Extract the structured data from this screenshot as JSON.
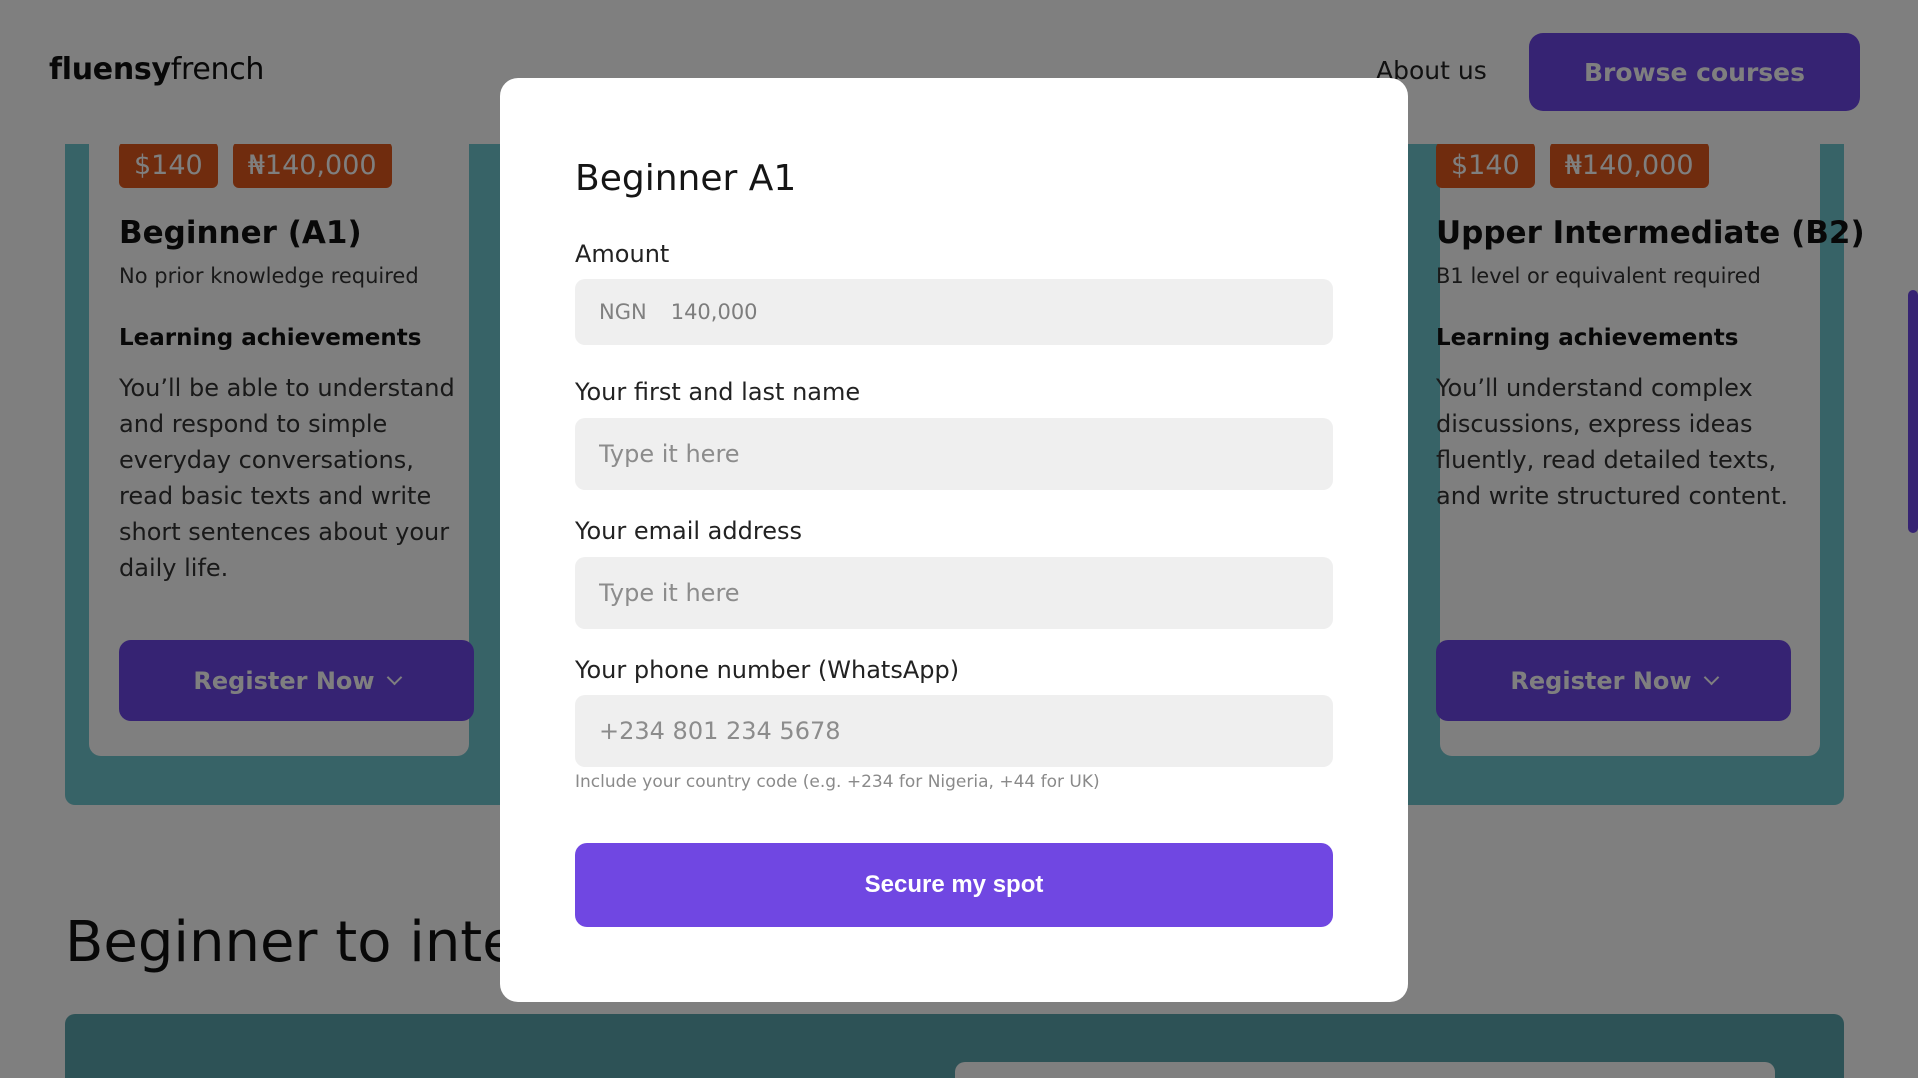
{
  "nav": {
    "logo_bold": "fluensy",
    "logo_rest": "french",
    "about_link": "About us",
    "browse_button": "Browse courses"
  },
  "cards": {
    "left": {
      "price_usd": "$140",
      "price_ngn": "₦140,000",
      "title": "Beginner (A1)",
      "subtitle": "No prior knowledge required",
      "heading": "Learning achievements",
      "body": "You’ll be able to understand and respond to simple everyday conversations, read basic texts and write short sentences about your daily life.",
      "button": "Register Now"
    },
    "right": {
      "price_usd": "$140",
      "price_ngn": "₦140,000",
      "title": "Upper Intermediate (B2)",
      "subtitle": "B1 level or equivalent required",
      "heading": "Learning achievements",
      "body": "You’ll understand complex discussions, express ideas fluently, read detailed texts, and write structured content.",
      "button": "Register Now"
    }
  },
  "section": {
    "title": "Beginner to interr"
  },
  "modal": {
    "title": "Beginner A1",
    "amount_label": "Amount",
    "amount_currency": "NGN",
    "amount_value": "140,000",
    "name_label": "Your first and last name",
    "name_placeholder": "Type it here",
    "email_label": "Your email address",
    "email_placeholder": "Type it here",
    "phone_label": "Your phone number (WhatsApp)",
    "phone_placeholder": "+234 801 234 5678",
    "phone_hint": "Include your country code (e.g. +234 for Nigeria, +44 for UK)",
    "submit": "Secure my spot"
  },
  "colors": {
    "accent": "#6d46e6",
    "price_tag": "#e0591c",
    "teal": "#6fc6ce"
  }
}
